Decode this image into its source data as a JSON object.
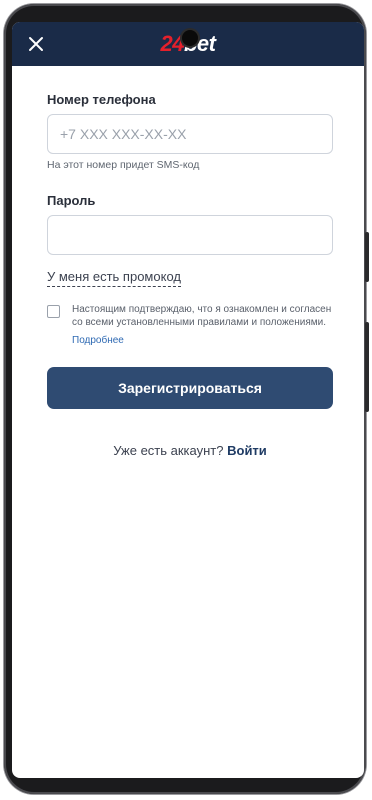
{
  "header": {
    "logo_number": "24",
    "logo_word": "bet",
    "close_icon": "close-icon"
  },
  "form": {
    "phone_label": "Номер телефона",
    "phone_placeholder": "+7 XXX XXX-XX-XX",
    "phone_value": "",
    "phone_hint": "На этот номер придет SMS-код",
    "password_label": "Пароль",
    "password_placeholder": "",
    "password_value": "",
    "promo_link": "У меня есть промокод",
    "agree_text": "Настоящим подтверждаю, что я ознакомлен и согласен со всеми установленными правилами и положениями.",
    "more_link": "Подробнее",
    "submit_label": "Зарегистрироваться",
    "have_account_text": "Уже есть аккаунт?",
    "login_link": "Войти"
  },
  "colors": {
    "header_bg": "#1a2b48",
    "logo_accent": "#e4202b",
    "button_bg": "#2f4b72",
    "link": "#2f6ab3"
  }
}
